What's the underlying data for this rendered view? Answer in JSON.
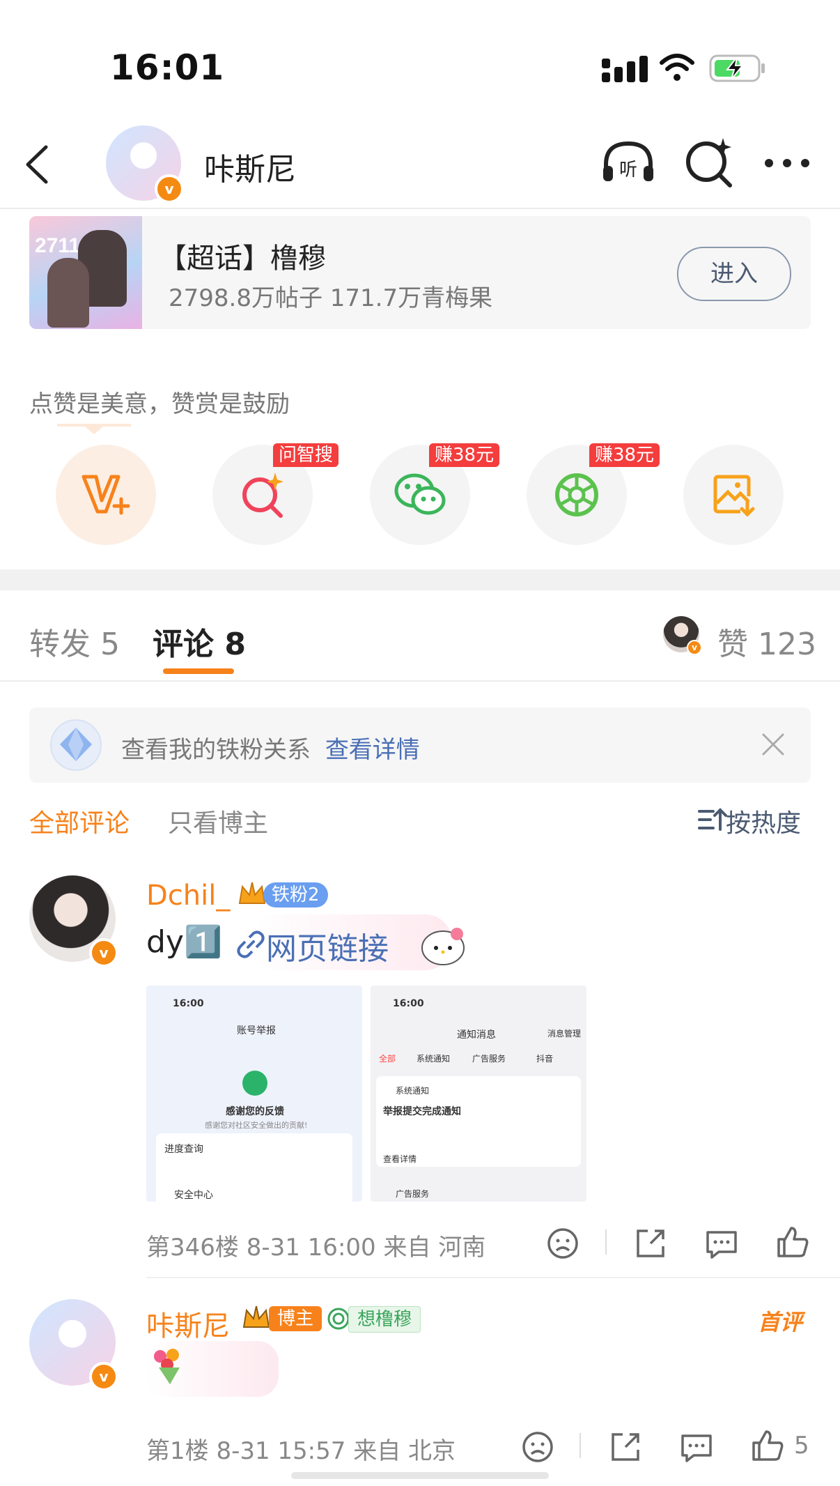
{
  "status_bar": {
    "time": "16:01"
  },
  "header": {
    "user_name": "咔斯尼"
  },
  "super_topic": {
    "title": "【超话】橹穆",
    "stats": "2798.8万帖子 171.7万青梅果",
    "enter_label": "进入",
    "thumb_text": "2711"
  },
  "like_section": {
    "tip": "点赞是美意，赞赏是鼓励",
    "actions": [
      {
        "icon": "v-plus-icon",
        "tag": ""
      },
      {
        "icon": "smart-search-icon",
        "tag": "问智搜"
      },
      {
        "icon": "wechat-icon",
        "tag": "赚38元"
      },
      {
        "icon": "moments-icon",
        "tag": "赚38元"
      },
      {
        "icon": "save-image-icon",
        "tag": ""
      }
    ]
  },
  "tabs": {
    "repost": "转发 5",
    "comments": "评论 8",
    "likes": "赞 123"
  },
  "fan_banner": {
    "text": "查看我的铁粉关系",
    "link": "查看详情"
  },
  "filters": {
    "all": "全部评论",
    "host_only": "只看博主",
    "sort": "按热度"
  },
  "comments": [
    {
      "name": "Dchil_",
      "badge": "铁粉2",
      "text_prefix": "dy1️⃣",
      "link_text": "网页链接",
      "meta": "第346楼 8-31 16:00 来自 河南",
      "images": [
        {
          "time": "16:00",
          "title": "账号举报",
          "line1": "感谢您的反馈",
          "line2": "感谢您对社区安全做出的贡献!",
          "line3": "进度查询",
          "line4": "安全中心"
        },
        {
          "time": "16:00",
          "title": "通知消息",
          "right": "消息管理",
          "chips": [
            "全部",
            "系统通知",
            "广告服务",
            "抖音"
          ],
          "line1": "系统通知",
          "line2": "举报提交完成通知",
          "line3": "查看详情",
          "line4": "广告服务"
        }
      ]
    },
    {
      "name": "咔斯尼",
      "badge": "博主",
      "badge2": "想橹穆",
      "first_label": "首评",
      "meta": "第1楼 8-31 15:57 来自 北京",
      "like_count": "5"
    }
  ]
}
